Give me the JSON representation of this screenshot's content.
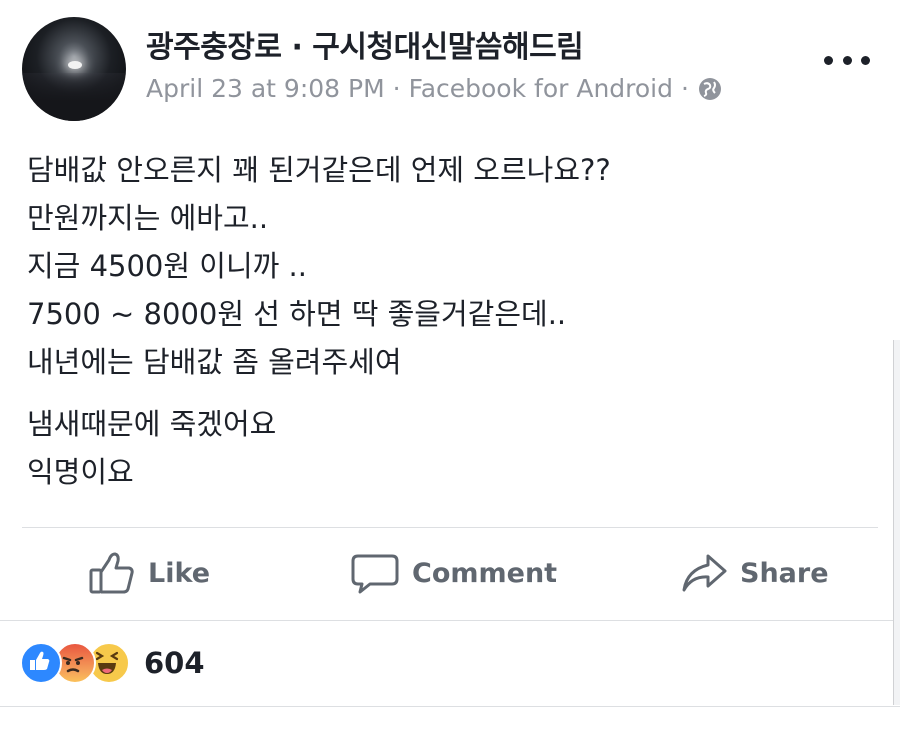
{
  "post": {
    "page_name": "광주충장로 · 구시청대신말씀해드림",
    "timestamp": "April 23 at 9:08 PM",
    "separator": "·",
    "source": "Facebook for Android",
    "privacy_icon": "globe-icon",
    "more_icon": "more-options-icon",
    "lines": [
      "담배값 안오른지 꽤 된거같은데 언제 오르나요??",
      "만원까지는 에바고..",
      "지금 4500원 이니까 ..",
      "7500 ~ 8000원 선 하면 딱 좋을거같은데..",
      "내년에는 담배값 좀 올려주세여"
    ],
    "lines_2": [
      "냄새때문에 죽겠어요",
      "익명이요"
    ]
  },
  "actions": {
    "like_label": "Like",
    "comment_label": "Comment",
    "share_label": "Share"
  },
  "reactions": {
    "types": [
      "like",
      "angry",
      "haha"
    ],
    "count": "604"
  },
  "colors": {
    "text": "#1d2129",
    "meta": "#90949c",
    "action": "#606770",
    "like_blue": "#2d88ff",
    "divider": "#dddfe2"
  }
}
